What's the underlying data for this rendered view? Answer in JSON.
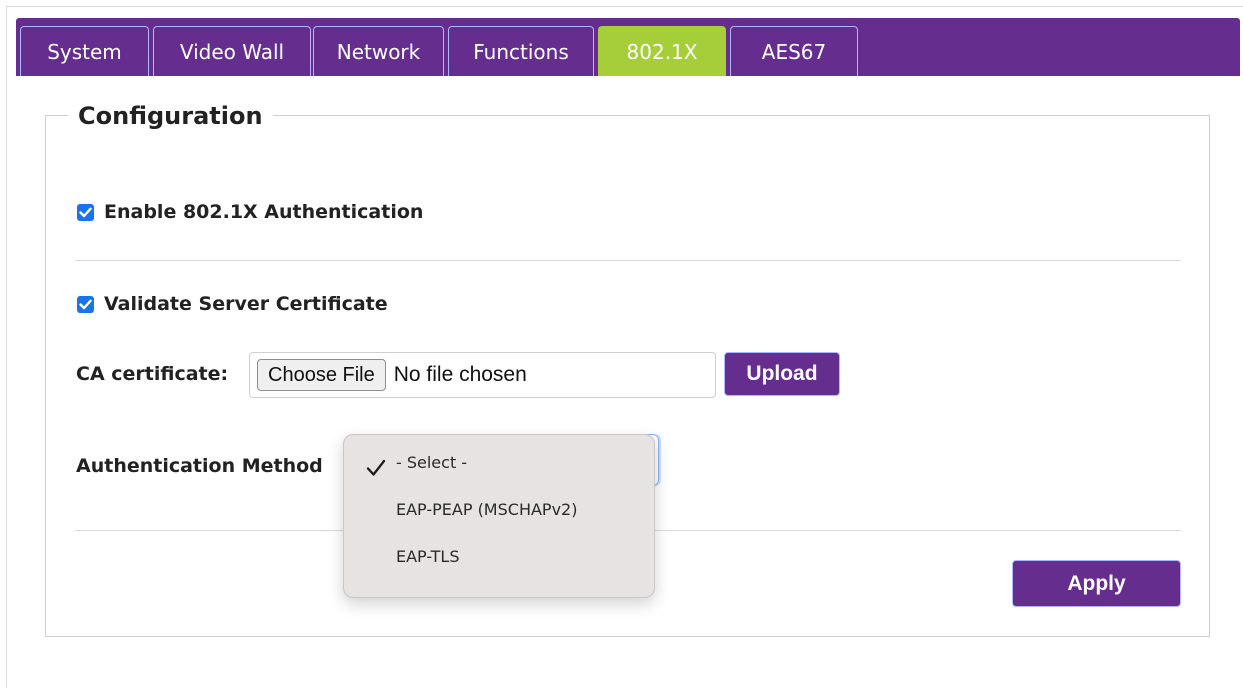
{
  "tabs": [
    {
      "label": "System",
      "active": false
    },
    {
      "label": "Video Wall",
      "active": false
    },
    {
      "label": "Network",
      "active": false
    },
    {
      "label": "Functions",
      "active": false
    },
    {
      "label": "802.1X",
      "active": true
    },
    {
      "label": "AES67",
      "active": false
    }
  ],
  "config": {
    "legend": "Configuration",
    "enable_auth": {
      "label": "Enable 802.1X Authentication",
      "checked": true
    },
    "validate_cert": {
      "label": "Validate Server Certificate",
      "checked": true
    },
    "ca_certificate": {
      "label": "CA certificate:",
      "choose_label": "Choose File",
      "file_status": "No file chosen",
      "upload_label": "Upload"
    },
    "auth_method": {
      "label": "Authentication Method",
      "selected": "- Select -",
      "options": [
        "- Select -",
        "EAP-PEAP (MSCHAPv2)",
        "EAP-TLS"
      ]
    },
    "apply_label": "Apply"
  },
  "colors": {
    "brand_purple": "#652d8e",
    "active_tab": "#a6ce39",
    "checkbox_blue": "#1a73e8",
    "dropdown_bg": "#e6e3e2"
  }
}
